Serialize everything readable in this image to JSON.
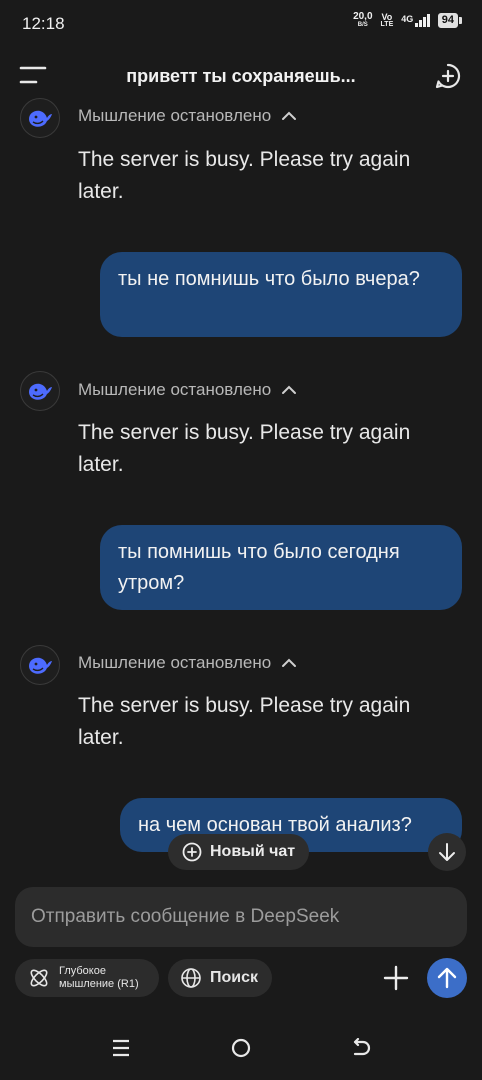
{
  "status_bar": {
    "time": "12:18",
    "speed_value": "20,0",
    "speed_unit": "B/S",
    "volte_top": "Vo",
    "volte_bottom": "LTE",
    "network": "4G",
    "battery": "94"
  },
  "header": {
    "title": "приветт ты сохраняешь..."
  },
  "messages": [
    {
      "role": "assistant",
      "status": "Мышление остановлено",
      "text": "The server is busy. Please try again later."
    },
    {
      "role": "user",
      "text": "ты не помнишь что было вчера?"
    },
    {
      "role": "assistant",
      "status": "Мышление остановлено",
      "text": "The server is busy. Please try again later."
    },
    {
      "role": "user",
      "text": "ты помнишь что было сегодня утром?"
    },
    {
      "role": "assistant",
      "status": "Мышление остановлено",
      "text": "The server is busy. Please try again later."
    },
    {
      "role": "user",
      "text": "на чем основан твой анализ?"
    }
  ],
  "floating": {
    "new_chat_label": "Новый чат"
  },
  "composer": {
    "placeholder": "Отправить сообщение в DeepSeek",
    "deep_think_label_1": "Глубокое",
    "deep_think_label_2": "мышление (R1)",
    "search_label": "Поиск"
  },
  "colors": {
    "background": "#1a1a1a",
    "user_bubble": "#1e4576",
    "send_button": "#3c6ec8",
    "brand_whale": "#4d6bfe"
  },
  "icons": [
    "menu-icon",
    "new-chat-icon",
    "deepseek-whale-icon",
    "chevron-up-icon",
    "plus-circle-icon",
    "arrow-down-icon",
    "atom-icon",
    "globe-icon",
    "plus-icon",
    "arrow-up-icon",
    "nav-menu-icon",
    "nav-home-icon",
    "nav-back-icon"
  ]
}
